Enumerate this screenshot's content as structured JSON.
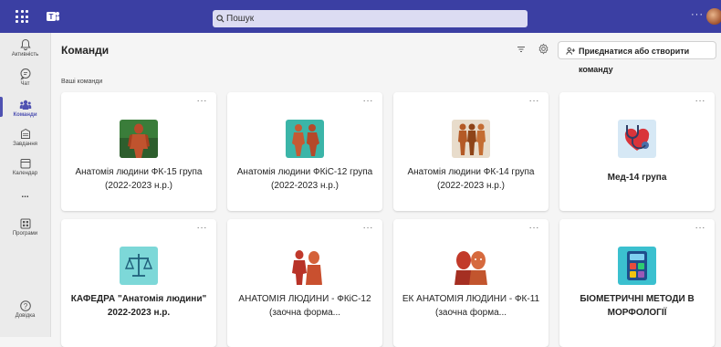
{
  "search": {
    "placeholder": "Пошук"
  },
  "rail": {
    "items": [
      {
        "label": "Активність"
      },
      {
        "label": "Чат"
      },
      {
        "label": "Команди"
      },
      {
        "label": "Завдання"
      },
      {
        "label": "Календар"
      },
      {
        "label": "..."
      },
      {
        "label": "Програми"
      },
      {
        "label": "Довідка"
      }
    ]
  },
  "header": {
    "title": "Команди",
    "join_label": "Приєднатися або створити команду"
  },
  "section_label": "Ваші команди",
  "teams": [
    {
      "name": "Анатомія людини ФК-15 група (2022-2023 н.р.)",
      "icon": "anatomy-muscle-figure"
    },
    {
      "name": "Анатомія людини ФКіС-12 група (2022-2023 н.р.)",
      "icon": "anatomy-figures-teal"
    },
    {
      "name": "Анатомія людини ФК-14 група (2022-2023 н.р.)",
      "icon": "anatomy-figures-orange"
    },
    {
      "name": "Мед-14 група",
      "icon": "stethoscope-heart"
    },
    {
      "name": "КАФЕДРА \"Анатомія людини\" 2022-2023 н.р.",
      "icon": "scales-icon"
    },
    {
      "name": "АНАТОМІЯ ЛЮДИНИ - ФКіС-12 (заочна форма...",
      "icon": "anatomy-body-red"
    },
    {
      "name": "ЕК АНАТОМІЯ ЛЮДИНИ - ФК-11 (заочна форма...",
      "icon": "anatomy-heads-red"
    },
    {
      "name": "БІОМЕТРИЧНІ МЕТОДИ В МОРФОЛОГІЇ",
      "icon": "calculator-icon"
    }
  ],
  "more_label": "···",
  "colors": {
    "topbar": "#3b3fa3",
    "accent": "#4f52b2"
  }
}
